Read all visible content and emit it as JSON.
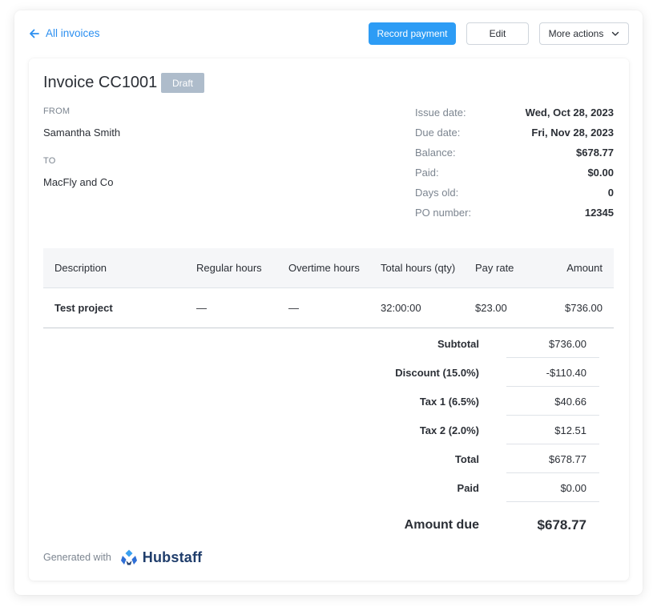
{
  "nav": {
    "back_label": "All invoices"
  },
  "actions": {
    "record_payment": "Record payment",
    "edit": "Edit",
    "more_actions": "More actions"
  },
  "invoice": {
    "title": "Invoice CC1001",
    "status": "Draft",
    "from_label": "FROM",
    "from_name": "Samantha Smith",
    "to_label": "TO",
    "to_name": "MacFly and Co"
  },
  "meta": [
    {
      "label": "Issue date:",
      "value": "Wed, Oct 28, 2023"
    },
    {
      "label": "Due date:",
      "value": "Fri, Nov 28, 2023"
    },
    {
      "label": "Balance:",
      "value": "$678.77"
    },
    {
      "label": "Paid:",
      "value": "$0.00"
    },
    {
      "label": "Days old:",
      "value": "0"
    },
    {
      "label": "PO number:",
      "value": "12345"
    }
  ],
  "table": {
    "headers": [
      "Description",
      "Regular hours",
      "Overtime hours",
      "Total hours (qty)",
      "Pay rate",
      "Amount"
    ],
    "rows": [
      [
        "Test project",
        "—",
        "—",
        "32:00:00",
        "$23.00",
        "$736.00"
      ]
    ]
  },
  "summary": [
    {
      "label": "Subtotal",
      "value": "$736.00"
    },
    {
      "label": "Discount (15.0%)",
      "value": "-$110.40"
    },
    {
      "label": "Tax 1 (6.5%)",
      "value": "$40.66"
    },
    {
      "label": "Tax 2 (2.0%)",
      "value": "$12.51"
    },
    {
      "label": "Total",
      "value": "$678.77"
    },
    {
      "label": "Paid",
      "value": "$0.00"
    }
  ],
  "amount_due": {
    "label": "Amount due",
    "value": "$678.77"
  },
  "footer": {
    "generated_with": "Generated with",
    "brand": "Hubstaff"
  },
  "colors": {
    "accent": "#2d9cf5",
    "badge": "#aebccb",
    "brand": "#1f3d6b"
  },
  "icons": {
    "back": "arrow-left-icon",
    "more": "chevron-down-icon",
    "logo": "hubstaff-logo-icon"
  }
}
